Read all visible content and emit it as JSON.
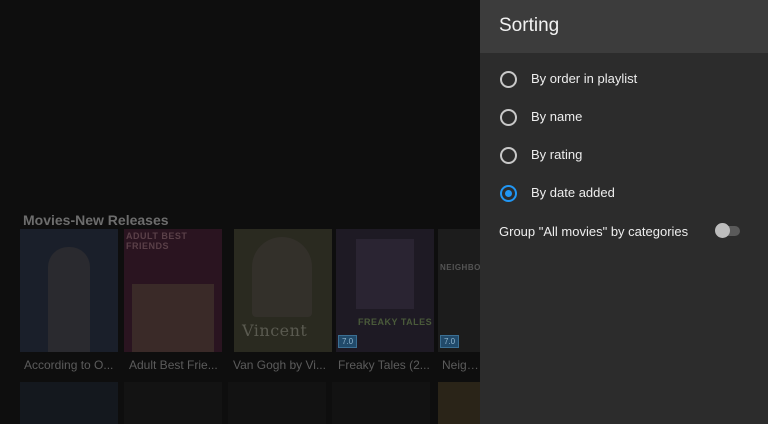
{
  "catalog": {
    "section_title": "Movies-New Releases",
    "cards": [
      {
        "title": "According to O..."
      },
      {
        "title": "Adult Best Frie...",
        "poster_text": "ADULT BEST FRIENDS"
      },
      {
        "title": "Van Gogh by Vi...",
        "poster_text": "Vincent"
      },
      {
        "title": "Freaky Tales (2...",
        "poster_text": "FREAKY TALES",
        "rating": "7.0"
      },
      {
        "title": "Neighb...",
        "poster_text": "NEIGHBORS",
        "rating": "7.0"
      }
    ]
  },
  "sorting": {
    "title": "Sorting",
    "options": [
      {
        "label": "By order in playlist",
        "selected": false
      },
      {
        "label": "By name",
        "selected": false
      },
      {
        "label": "By rating",
        "selected": false
      },
      {
        "label": "By date added",
        "selected": true
      }
    ],
    "group_toggle": {
      "label": "Group \"All movies\" by categories",
      "enabled": false
    }
  },
  "colors": {
    "accent": "#2196f3",
    "panel_bg": "#2c2c2c",
    "panel_header_bg": "#3c3c3c"
  }
}
